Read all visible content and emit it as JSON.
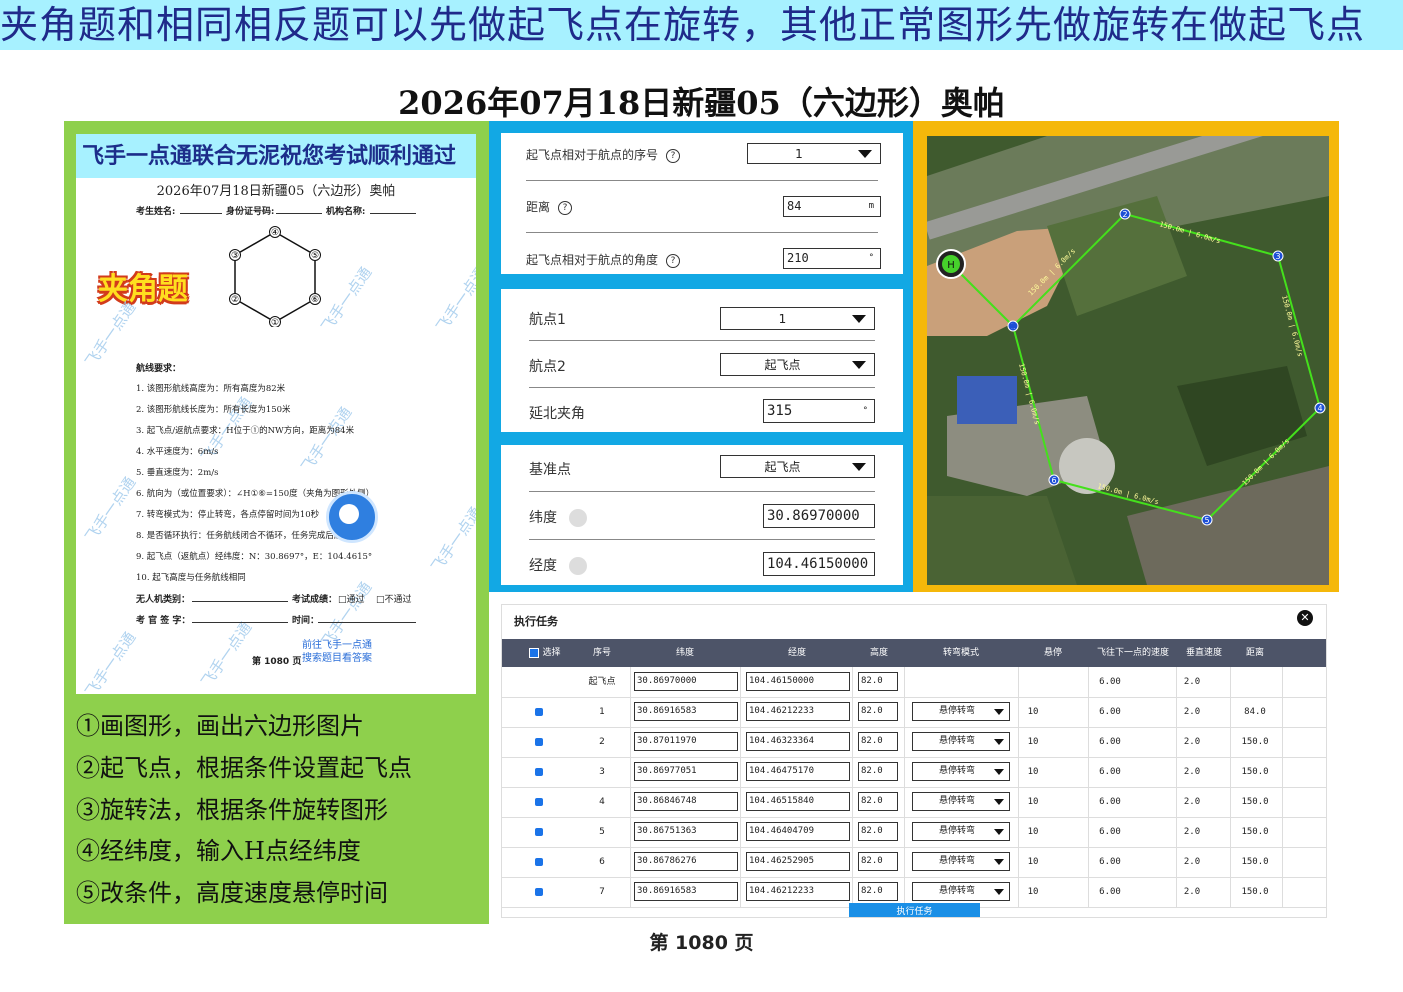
{
  "banner": "夹角题和相同相反题可以先做起飞点在旋转，其他正常图形先做旋转在做起飞点",
  "title": "2026年07月18日新疆05（六边形）奥帕",
  "paper": {
    "banner": "飞手一点通联合无泥祝您考试顺利通过",
    "title": "2026年07月18日新疆05（六边形）奥帕",
    "field_name": "考生姓名:",
    "field_id": "身份证号码:",
    "field_org": "机构名称:",
    "stamp": "夹角题",
    "points": [
      "①",
      "②",
      "③",
      "④",
      "⑤",
      "⑥"
    ],
    "req_title": "航线要求：",
    "requirements": [
      "1.  该图形航线高度为：所有高度为82米",
      "2.  该图形航线长度为：所有长度为150米",
      "3.  起飞点/返航点要求：H位于①的NW方向，距离为84米",
      "4.  水平速度为：6m/s",
      "5.  垂直速度为：2m/s",
      "6.  航向为（或位置要求）：∠H①⑥=150度（夹角为图形外侧）",
      "7.  转弯模式为：停止转弯，各点停留时间为10秒",
      "8.  是否循环执行：任务航线闭合不循环，任务完成后原地悬停",
      "9.  起飞点（返航点）经纬度：N：30.8697°，E：104.4615°",
      "10. 起飞高度与任务航线相同"
    ],
    "uav_type": "无人机类别：",
    "result": "考试成绩：",
    "pass": "□通过",
    "fail": "□不通过",
    "examiner": "考 官 签 字：",
    "time": "时间：",
    "watermark": "飞手一点通",
    "go_line1": "前往飞手一点通",
    "go_line2": "搜索题目看答案",
    "page_small": "第 1080 页"
  },
  "steps": [
    "①画图形，画出六边形图片",
    "②起飞点，根据条件设置起飞点",
    "③旋转法，根据条件旋转图形",
    "④经纬度，输入H点经纬度",
    "⑤改条件，高度速度悬停时间"
  ],
  "settings1": {
    "seq_label": "起飞点相对于航点的序号",
    "seq_value": "1",
    "dist_label": "距离",
    "dist_value": "84",
    "dist_unit": "m",
    "angle_label": "起飞点相对于航点的角度",
    "angle_value": "210",
    "angle_unit": "°",
    "help": "?"
  },
  "settings2": {
    "wp1_label": "航点1",
    "wp1_value": "1",
    "wp2_label": "航点2",
    "wp2_value": "起飞点",
    "north_label": "延北夹角",
    "north_value": "315",
    "north_unit": "°"
  },
  "settings3": {
    "base_label": "基准点",
    "base_value": "起飞点",
    "lat_label": "纬度",
    "lat_value": "30.86970000",
    "lng_label": "经度",
    "lng_value": "104.46150000"
  },
  "map": {
    "home_label": "H",
    "seg_label": "150.0m | 6.0m/s",
    "markers": [
      "1",
      "2",
      "3",
      "4",
      "5",
      "6",
      "7"
    ]
  },
  "task": {
    "title": "执行任务",
    "close": "✕",
    "headers": [
      "选择",
      "序号",
      "纬度",
      "经度",
      "高度",
      "转弯模式",
      "悬停",
      "飞往下一点的速度",
      "垂直速度",
      "距离"
    ],
    "rows": [
      {
        "seq": "起飞点",
        "lat": "30.86970000",
        "lng": "104.46150000",
        "alt": "82.0",
        "mode": "",
        "hover": "",
        "speed": "6.00",
        "vspeed": "2.0",
        "dist": "",
        "check": false
      },
      {
        "seq": "1",
        "lat": "30.86916583",
        "lng": "104.46212233",
        "alt": "82.0",
        "mode": "悬停转弯",
        "hover": "10",
        "speed": "6.00",
        "vspeed": "2.0",
        "dist": "84.0",
        "check": true
      },
      {
        "seq": "2",
        "lat": "30.87011970",
        "lng": "104.46323364",
        "alt": "82.0",
        "mode": "悬停转弯",
        "hover": "10",
        "speed": "6.00",
        "vspeed": "2.0",
        "dist": "150.0",
        "check": true
      },
      {
        "seq": "3",
        "lat": "30.86977051",
        "lng": "104.46475170",
        "alt": "82.0",
        "mode": "悬停转弯",
        "hover": "10",
        "speed": "6.00",
        "vspeed": "2.0",
        "dist": "150.0",
        "check": true
      },
      {
        "seq": "4",
        "lat": "30.86846748",
        "lng": "104.46515840",
        "alt": "82.0",
        "mode": "悬停转弯",
        "hover": "10",
        "speed": "6.00",
        "vspeed": "2.0",
        "dist": "150.0",
        "check": true
      },
      {
        "seq": "5",
        "lat": "30.86751363",
        "lng": "104.46404709",
        "alt": "82.0",
        "mode": "悬停转弯",
        "hover": "10",
        "speed": "6.00",
        "vspeed": "2.0",
        "dist": "150.0",
        "check": true
      },
      {
        "seq": "6",
        "lat": "30.86786276",
        "lng": "104.46252905",
        "alt": "82.0",
        "mode": "悬停转弯",
        "hover": "10",
        "speed": "6.00",
        "vspeed": "2.0",
        "dist": "150.0",
        "check": true
      },
      {
        "seq": "7",
        "lat": "30.86916583",
        "lng": "104.46212233",
        "alt": "82.0",
        "mode": "悬停转弯",
        "hover": "10",
        "speed": "6.00",
        "vspeed": "2.0",
        "dist": "150.0",
        "check": true
      }
    ],
    "exec_button": "执行任务"
  },
  "page_number": "第 1080 页"
}
